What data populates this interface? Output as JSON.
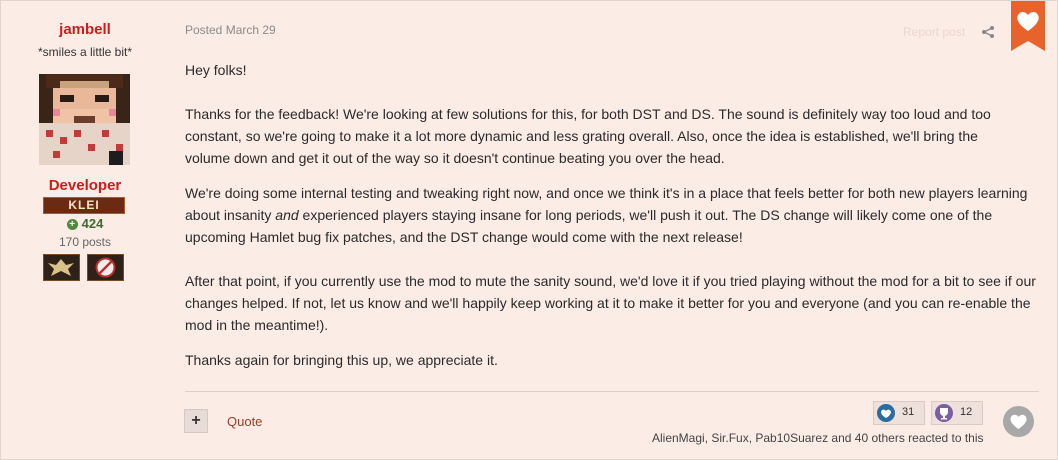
{
  "author": {
    "name": "jambell",
    "title": "*smiles a little bit*",
    "group": "Developer",
    "group_badge": "KLEI",
    "reputation": "424",
    "posts": "170 posts"
  },
  "post": {
    "posted": "Posted March 29",
    "report": "Report post",
    "paragraphs": [
      "Hey folks!",
      "Thanks for the feedback! We're looking at few solutions for this, for both DST and DS. The sound is definitely way too loud and too constant, so we're going to make it a lot more dynamic and less grating overall. Also, once the idea is established, we'll bring the volume down and get it out of the way so it doesn't continue beating you over the head.",
      "We're doing some internal testing and tweaking right now, and once we think it's in a place that feels better for both new players learning about insanity ",
      "and",
      " experienced players staying insane for long periods, we'll push it out. The DS change will likely come one of the upcoming Hamlet bug fix patches, and the DST change would come with the next release!",
      "After that point, if you currently use the mod to mute the sanity sound, we'd love it if you tried playing without the mod for a bit to see if our changes helped. If not, let us know and we'll happily keep working at it to make it better for you and everyone (and you can re-enable the mod in the meantime!).",
      "Thanks again for bringing this up, we appreciate it."
    ]
  },
  "footer": {
    "quote": "Quote",
    "plus": "+",
    "reactions": [
      {
        "icon": "like-icon",
        "count": "31",
        "color": "#2a6ba0"
      },
      {
        "icon": "trophy-icon",
        "count": "12",
        "color": "#7b5ea3"
      }
    ],
    "reacted_text": "AlienMagi, Sir.Fux, Pab10Suarez and 40 others reacted to this"
  },
  "colors": {
    "accent_red": "#cc1d1d",
    "ribbon": "#e8632b",
    "background": "#fcece6"
  }
}
